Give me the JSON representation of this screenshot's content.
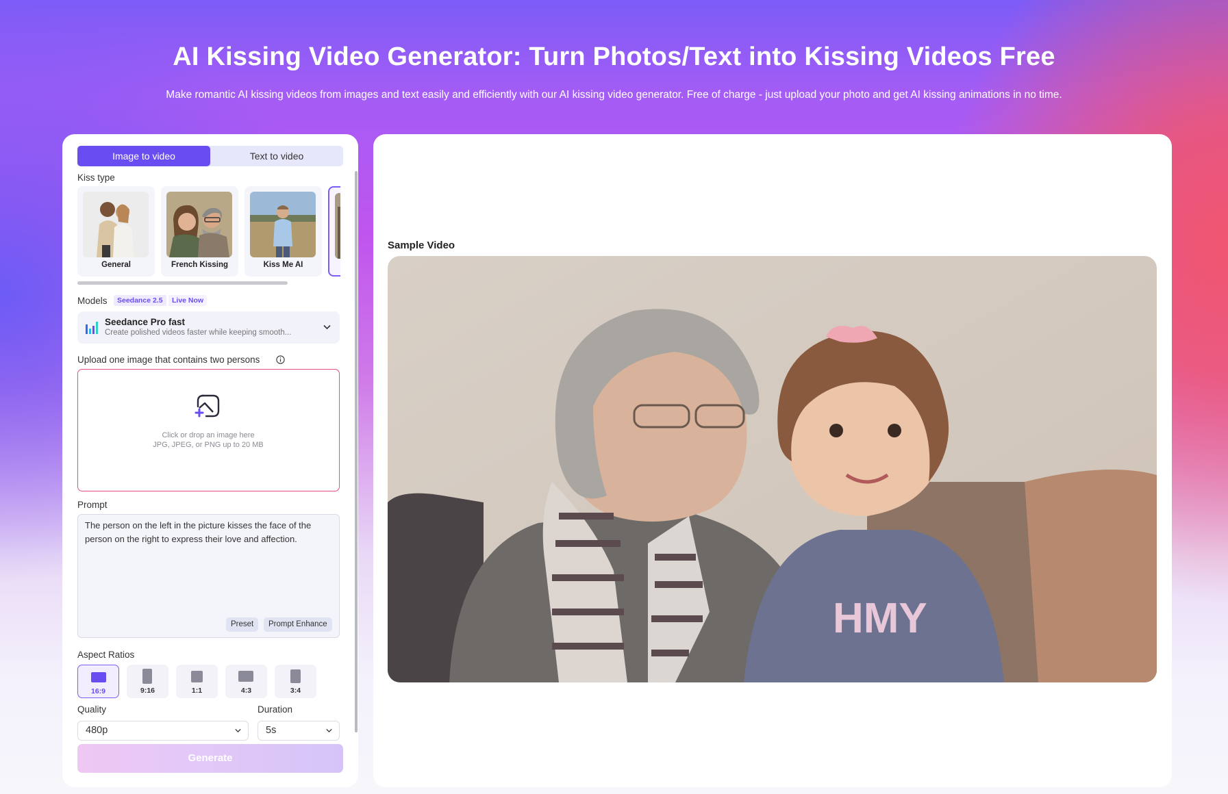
{
  "hero": {
    "title": "AI Kissing Video Generator: Turn Photos/Text into Kissing Videos Free",
    "subtitle": "Make romantic AI kissing videos from images and text easily and efficiently with our AI kissing video generator. Free of charge - just upload your photo and get AI kissing animations in no time."
  },
  "tabs": {
    "image_to_video": "Image to video",
    "text_to_video": "Text to video",
    "active": "image_to_video"
  },
  "kiss_type": {
    "label": "Kiss type",
    "items": [
      {
        "name": "General"
      },
      {
        "name": "French Kissing"
      },
      {
        "name": "Kiss Me AI"
      }
    ]
  },
  "models": {
    "label": "Models",
    "badge_version": "Seedance 2.5",
    "badge_status": "Live Now",
    "selected_name": "Seedance Pro fast",
    "selected_desc": "Create polished videos faster while keeping smooth..."
  },
  "upload": {
    "label": "Upload one image that contains two persons",
    "hint": "Click or drop an image here",
    "formats": "JPG, JPEG, or PNG up to 20 MB"
  },
  "prompt": {
    "label": "Prompt",
    "value": "The person on the left in the picture kisses the face of the person on the right to express their love and affection.",
    "preset_label": "Preset",
    "enhance_label": "Prompt Enhance"
  },
  "aspect_ratios": {
    "label": "Aspect Ratios",
    "items": [
      "16:9",
      "9:16",
      "1:1",
      "4:3",
      "3:4"
    ],
    "selected": "16:9"
  },
  "quality": {
    "label": "Quality",
    "value": "480p"
  },
  "duration": {
    "label": "Duration",
    "value": "5s"
  },
  "generate_label": "Generate",
  "sample": {
    "label": "Sample Video"
  },
  "colors": {
    "accent": "#6a4df0",
    "upload_border": "#e5507a",
    "badge_bg": "#efeaff"
  }
}
